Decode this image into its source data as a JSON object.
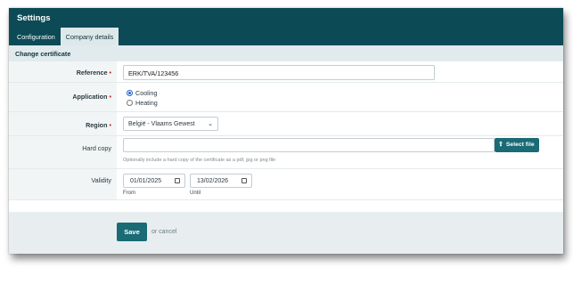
{
  "header": {
    "title": "Settings"
  },
  "tabs": [
    {
      "label": "Configuration",
      "active": false
    },
    {
      "label": "Company details",
      "active": true
    }
  ],
  "section": {
    "title": "Change certificate"
  },
  "form": {
    "reference": {
      "label": "Reference",
      "required": "•",
      "value": "ERK/TVA/123456"
    },
    "application": {
      "label": "Application",
      "required": "•",
      "options": [
        "Cooling",
        "Heating"
      ],
      "selected": "Cooling"
    },
    "region": {
      "label": "Region",
      "required": "•",
      "value": "België - Vlaams Gewest"
    },
    "hard_copy": {
      "label": "Hard copy",
      "button": "Select file",
      "hint": "Optionally include a hard copy of the certificate as a pdf, jpg or png file"
    },
    "validity": {
      "label": "Validity",
      "from": "01/01/2025",
      "until": "13/02/2026",
      "from_label": "From",
      "until_label": "Until"
    }
  },
  "footer": {
    "save": "Save",
    "cancel": "or cancel"
  },
  "colors": {
    "brand": "#0c4a56",
    "button": "#1a6b75",
    "required": "#d2232a"
  }
}
